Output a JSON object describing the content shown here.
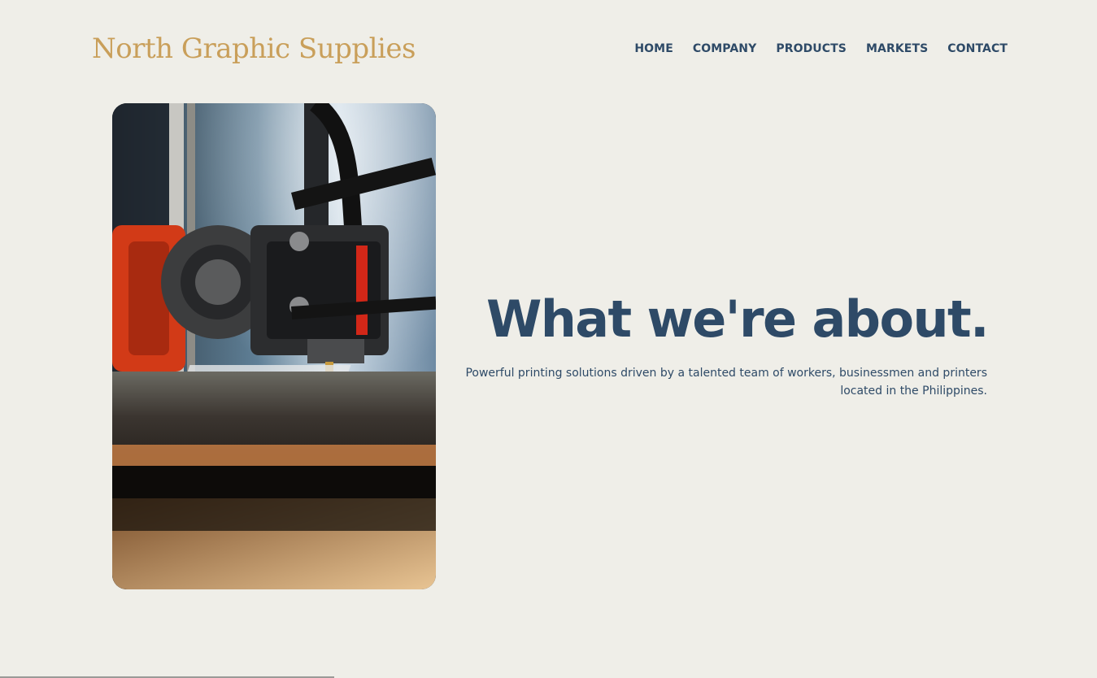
{
  "header": {
    "brand": "North Graphic Supplies",
    "nav": [
      "HOME",
      "COMPANY",
      "PRODUCTS",
      "MARKETS",
      "CONTACT"
    ]
  },
  "hero": {
    "image_subject": "3d-printer-extruder-closeup",
    "headline": "What we're about.",
    "tagline": "Powerful printing solutions driven by a talented team of workers, businessmen and printers located in the Philippines."
  },
  "colors": {
    "background": "#efeee8",
    "brand": "#c99f5a",
    "text": "#2e4a67"
  }
}
